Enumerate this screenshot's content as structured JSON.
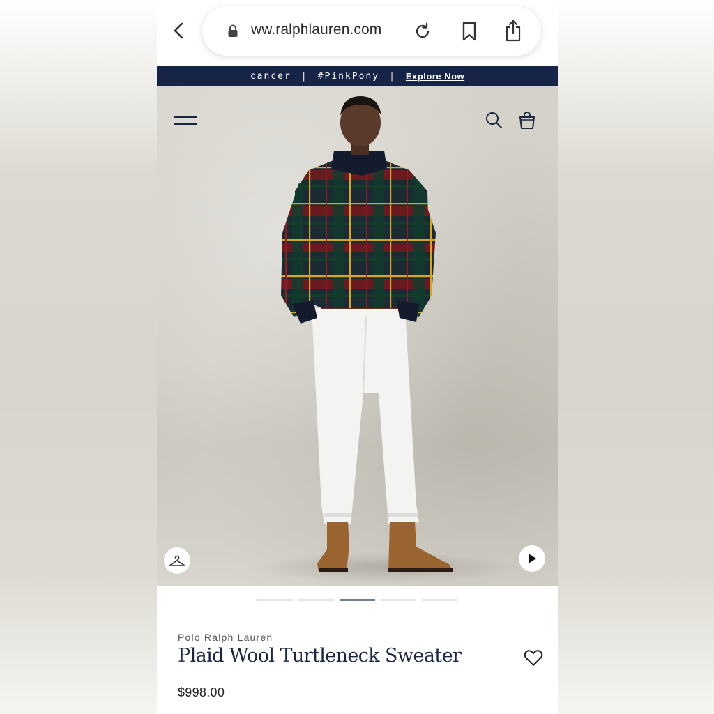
{
  "browser": {
    "url": "ww.ralphlauren.com",
    "icons": [
      "back-chevron-icon",
      "lock-icon",
      "reload-icon",
      "bookmark-icon",
      "share-icon"
    ]
  },
  "promo_banner": {
    "text": "cancer",
    "separator": "|",
    "hashtag": "#PinkPony",
    "cta": "Explore Now",
    "background": "#152447"
  },
  "header": {
    "icons": [
      "menu-icon",
      "search-icon",
      "shopping-bag-icon"
    ]
  },
  "hero": {
    "overlay_icons": [
      "hanger-icon",
      "play-icon"
    ],
    "carousel": {
      "count": 5,
      "active_index": 2
    }
  },
  "product": {
    "brand": "Polo Ralph Lauren",
    "name": "Plaid Wool Turtleneck Sweater",
    "price": "$998.00",
    "wishlist_icon": "heart-icon"
  },
  "colors": {
    "navy": "#152447",
    "title_text": "#1b2640"
  }
}
